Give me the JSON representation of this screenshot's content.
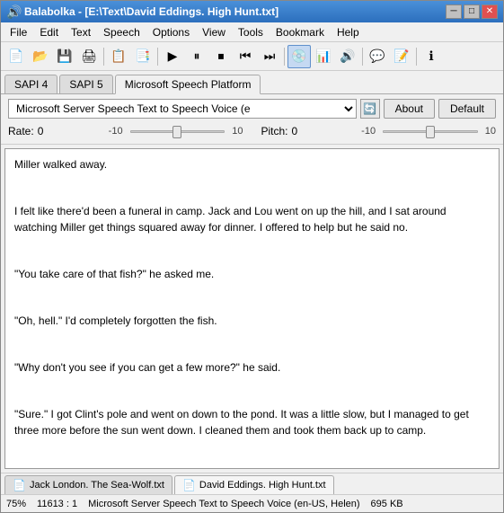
{
  "window": {
    "title": "Balabolka - [E:\\Text\\David Eddings. High Hunt.txt]",
    "icon": "🔊"
  },
  "titlebar": {
    "minimize_label": "─",
    "restore_label": "□",
    "close_label": "✕"
  },
  "menu": {
    "items": [
      "File",
      "Edit",
      "Text",
      "Speech",
      "Options",
      "View",
      "Tools",
      "Bookmark",
      "Help"
    ]
  },
  "toolbar": {
    "buttons": [
      {
        "icon": "📄",
        "name": "new"
      },
      {
        "icon": "📂",
        "name": "open"
      },
      {
        "icon": "💾",
        "name": "save"
      },
      {
        "icon": "🖨",
        "name": "print"
      },
      {
        "icon": "📋",
        "name": "paste"
      },
      {
        "icon": "▶",
        "name": "play"
      },
      {
        "icon": "⏸",
        "name": "pause"
      },
      {
        "icon": "⏹",
        "name": "stop"
      },
      {
        "icon": "⏮",
        "name": "prev"
      },
      {
        "icon": "⏭",
        "name": "next"
      },
      {
        "icon": "📊",
        "name": "chart"
      },
      {
        "icon": "🔊",
        "name": "volume"
      },
      {
        "icon": "💬",
        "name": "text-to-speech"
      },
      {
        "icon": "📝",
        "name": "edit"
      },
      {
        "icon": "ℹ",
        "name": "info"
      }
    ]
  },
  "tabs": {
    "items": [
      "SAPI 4",
      "SAPI 5",
      "Microsoft Speech Platform"
    ],
    "active": 2
  },
  "voice_panel": {
    "voice_name": "Microsoft Server Speech Text to Speech Voice (e",
    "voice_placeholder": "Microsoft Server Speech Text to Speech Voice (e",
    "refresh_icon": "🔄",
    "about_label": "About",
    "default_label": "Default"
  },
  "sliders": {
    "rate": {
      "label": "Rate:",
      "value": "0",
      "min": "-10",
      "max": "10"
    },
    "pitch": {
      "label": "Pitch:",
      "value": "0",
      "min": "-10",
      "max": "10"
    }
  },
  "text_content": [
    "Miller walked away.",
    "",
    "I felt like there'd been a funeral in camp. Jack and Lou went on up the hill, and I sat around watching Miller get things squared away for dinner. I offered to help but he said no.",
    "",
    "\"You take care of that fish?\" he asked me.",
    "",
    "\"Oh, hell.\" I'd completely forgotten the fish.",
    "",
    "\"Why don't you see if you can get a few more?\" he said.",
    "",
    "\"Sure.\" I got Clint's pole and went on down to the pond. It was a little slow, but I managed to get three more before the sun went down. I cleaned them and took them back up to camp."
  ],
  "doc_tabs": {
    "items": [
      {
        "label": "Jack London. The Sea-Wolf.txt",
        "icon": "📄",
        "active": false
      },
      {
        "label": "David Eddings. High Hunt.txt",
        "icon": "📄",
        "active": true
      }
    ]
  },
  "status_bar": {
    "zoom": "75%",
    "position": "11613 : 1",
    "voice": "Microsoft Server Speech Text to Speech Voice (en-US, Helen)",
    "size": "695 KB"
  }
}
